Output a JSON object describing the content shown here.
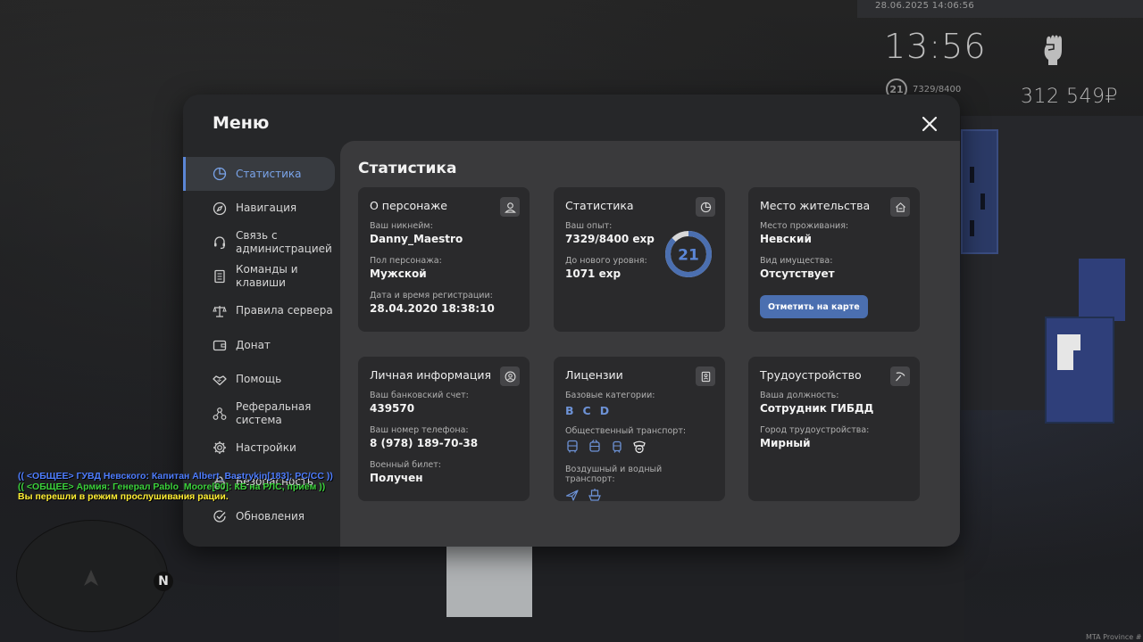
{
  "hud": {
    "datetime": "28.06.2025 14:06:56",
    "clock": "13:56",
    "level": "21",
    "xp": "7329/8400",
    "money": "312 549₽",
    "watermark": "MTA Province #"
  },
  "chat": [
    "(( <ОБЩЕЕ> ГУВД Невского: Капитан Albert_Bastrykin[183]: PC/CC ))",
    "(( <ОБЩЕЕ> Армия: Генерал Pablo_Moore[90]: КБ на РЛС, приём ))",
    "Вы перешли в режим прослушивания рации."
  ],
  "minimap": {
    "north": "N"
  },
  "menu": {
    "title": "Меню",
    "sidebar": [
      {
        "label": "Статистика",
        "icon": "pie-chart-icon",
        "active": true
      },
      {
        "label": "Навигация",
        "icon": "compass-icon"
      },
      {
        "label": "Связь с администрацией",
        "icon": "headset-icon"
      },
      {
        "label": "Команды и клавиши",
        "icon": "document-icon"
      },
      {
        "label": "Правила сервера",
        "icon": "scales-icon"
      },
      {
        "label": "Донат",
        "icon": "wallet-icon"
      },
      {
        "label": "Помощь",
        "icon": "handshake-icon"
      },
      {
        "label": "Реферальная система",
        "icon": "network-icon"
      },
      {
        "label": "Настройки",
        "icon": "gear-icon"
      },
      {
        "label": "Безопасность",
        "icon": "lock-icon"
      },
      {
        "label": "Обновления",
        "icon": "check-circle-icon"
      }
    ],
    "content_title": "Статистика",
    "character": {
      "title": "О персонаже",
      "nickname_label": "Ваш никнейм:",
      "nickname": "Danny_Maestro",
      "gender_label": "Пол персонажа:",
      "gender": "Мужской",
      "reg_label": "Дата и время регистрации:",
      "reg": "28.04.2020 18:38:10"
    },
    "stats": {
      "title": "Статистика",
      "xp_label": "Ваш опыт:",
      "xp": "7329/8400 exp",
      "next_label": "До нового уровня:",
      "next": "1071 exp",
      "level": "21",
      "progress": 0.8725
    },
    "residence": {
      "title": "Место жительства",
      "place_label": "Место проживания:",
      "place": "Невский",
      "property_label": "Вид имущества:",
      "property": "Отсутствует",
      "button": "Отметить на карте"
    },
    "personal": {
      "title": "Личная информация",
      "bank_label": "Ваш банковский счет:",
      "bank": "439570",
      "phone_label": "Ваш номер телефона:",
      "phone": "8 (978) 189-70-38",
      "military_label": "Военный билет:",
      "military": "Получен"
    },
    "licenses": {
      "title": "Лицензии",
      "base_label": "Базовые категории:",
      "base": [
        "B",
        "C",
        "D"
      ],
      "public_label": "Общественный транспорт:",
      "air_label": "Воздушный и водный транспорт:"
    },
    "job": {
      "title": "Трудоустройство",
      "position_label": "Ваша должность:",
      "position": "Сотрудник ГИБДД",
      "city_label": "Город трудоустройства:",
      "city": "Мирный"
    },
    "colors": {
      "accent": "#5b86d6",
      "button": "#4b6fb0",
      "card": "#2a2a2c",
      "panel": "#3a3a3c"
    }
  }
}
